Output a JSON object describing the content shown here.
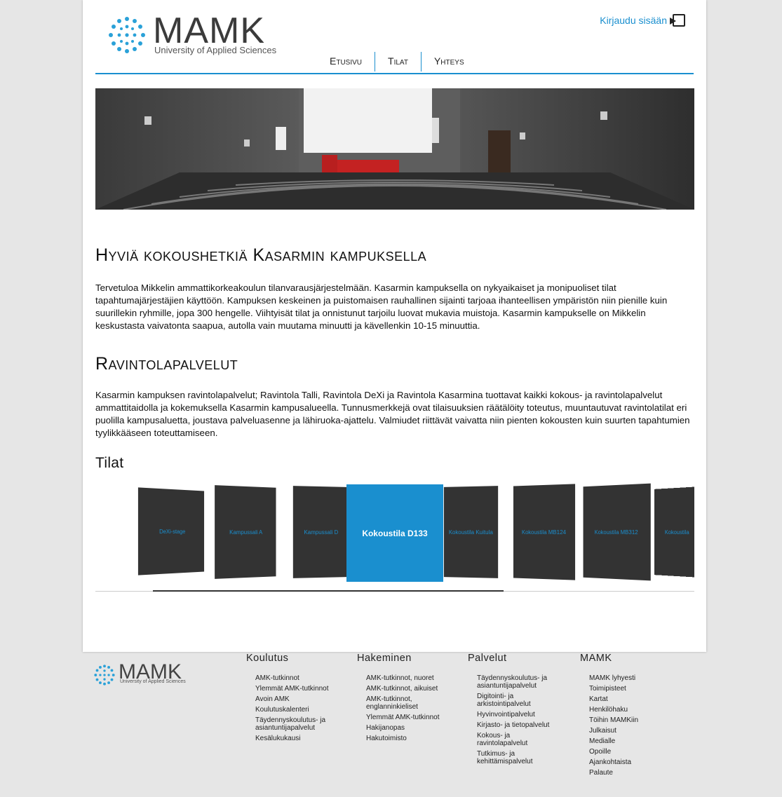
{
  "header": {
    "logo_word": "MAMK",
    "logo_sub": "University of Applied Sciences",
    "login_label": "Kirjaudu sisään",
    "nav": [
      "Etusivu",
      "Tilat",
      "Yhteys"
    ]
  },
  "main": {
    "title": "Hyviä kokoushetkiä Kasarmin kampuksella",
    "intro": "Tervetuloa Mikkelin ammattikorkeakoulun tilanvarausjärjestelmään. Kasarmin kampuksella on nykyaikaiset ja monipuoliset tilat tapahtumajärjestäjien käyttöön. Kampuksen keskeinen ja puistomaisen rauhallinen sijainti tarjoaa ihanteellisen ympäristön niin pienille kuin suurillekin ryhmille, jopa 300 hengelle. Viihtyisät tilat ja onnistunut tarjoilu luovat mukavia muistoja. Kasarmin kampukselle on Mikkelin keskustasta vaivatonta saapua, autolla vain muutama minuutti ja kävellenkin 10-15 minuuttia.",
    "restaurant_title": "Ravintolapalvelut",
    "restaurant_text": "Kasarmin kampuksen ravintolapalvelut; Ravintola Talli, Ravintola DeXi ja Ravintola Kasarmina tuottavat kaikki kokous- ja ravintolapalvelut ammattitaidolla ja kokemuksella Kasarmin kampusalueella. Tunnusmerkkejä ovat tilaisuuksien räätälöity toteutus, muuntautuvat ravintolatilat eri puolilla kampusaluetta, joustava palveluasenne ja lähiruoka-ajattelu. Valmiudet riittävät vaivatta niin pienten kokousten kuin suurten tapahtumien tyylikkääseen toteuttamiseen.",
    "spaces_title": "Tilat",
    "carousel": [
      "DeXi-stage",
      "Kampussali A",
      "Kampussali D",
      "Kokoustila D133",
      "Kokoustila Kuitula",
      "Kokoustila MB124",
      "Kokoustila MB312",
      "Kokoustila"
    ]
  },
  "footer": {
    "logo_word": "MAMK",
    "logo_sub": "University of Applied Sciences",
    "columns": [
      {
        "title": "Koulutus",
        "items": [
          "AMK-tutkinnot",
          "Ylemmät AMK-tutkinnot",
          "Avoin AMK",
          "Koulutuskalenteri",
          "Täydennyskoulutus- ja asiantuntijapalvelut",
          "Kesälukukausi"
        ]
      },
      {
        "title": "Hakeminen",
        "items": [
          "AMK-tutkinnot, nuoret",
          "AMK-tutkinnot, aikuiset",
          "AMK-tutkinnot, englanninkieliset",
          "Ylemmät AMK-tutkinnot",
          "Hakijanopas",
          "Hakutoimisto"
        ]
      },
      {
        "title": "Palvelut",
        "items": [
          "Täydennyskoulutus- ja asiantuntijapalvelut",
          "Digitointi- ja arkistointipalvelut",
          "Hyvinvointipalvelut",
          "Kirjasto- ja tietopalvelut",
          "Kokous- ja ravintolapalvelut",
          "Tutkimus- ja kehittämispalvelut"
        ]
      },
      {
        "title": "MAMK",
        "items": [
          "MAMK lyhyesti",
          "Toimipisteet",
          "Kartat",
          "Henkilöhaku",
          "Töihin MAMKiin",
          "Julkaisut",
          "Medialle",
          "Opoille",
          "Ajankohtaista",
          "Palaute"
        ]
      }
    ]
  },
  "colors": {
    "accent": "#1a8fcf",
    "card": "#333333",
    "background": "#e6e6e6"
  }
}
